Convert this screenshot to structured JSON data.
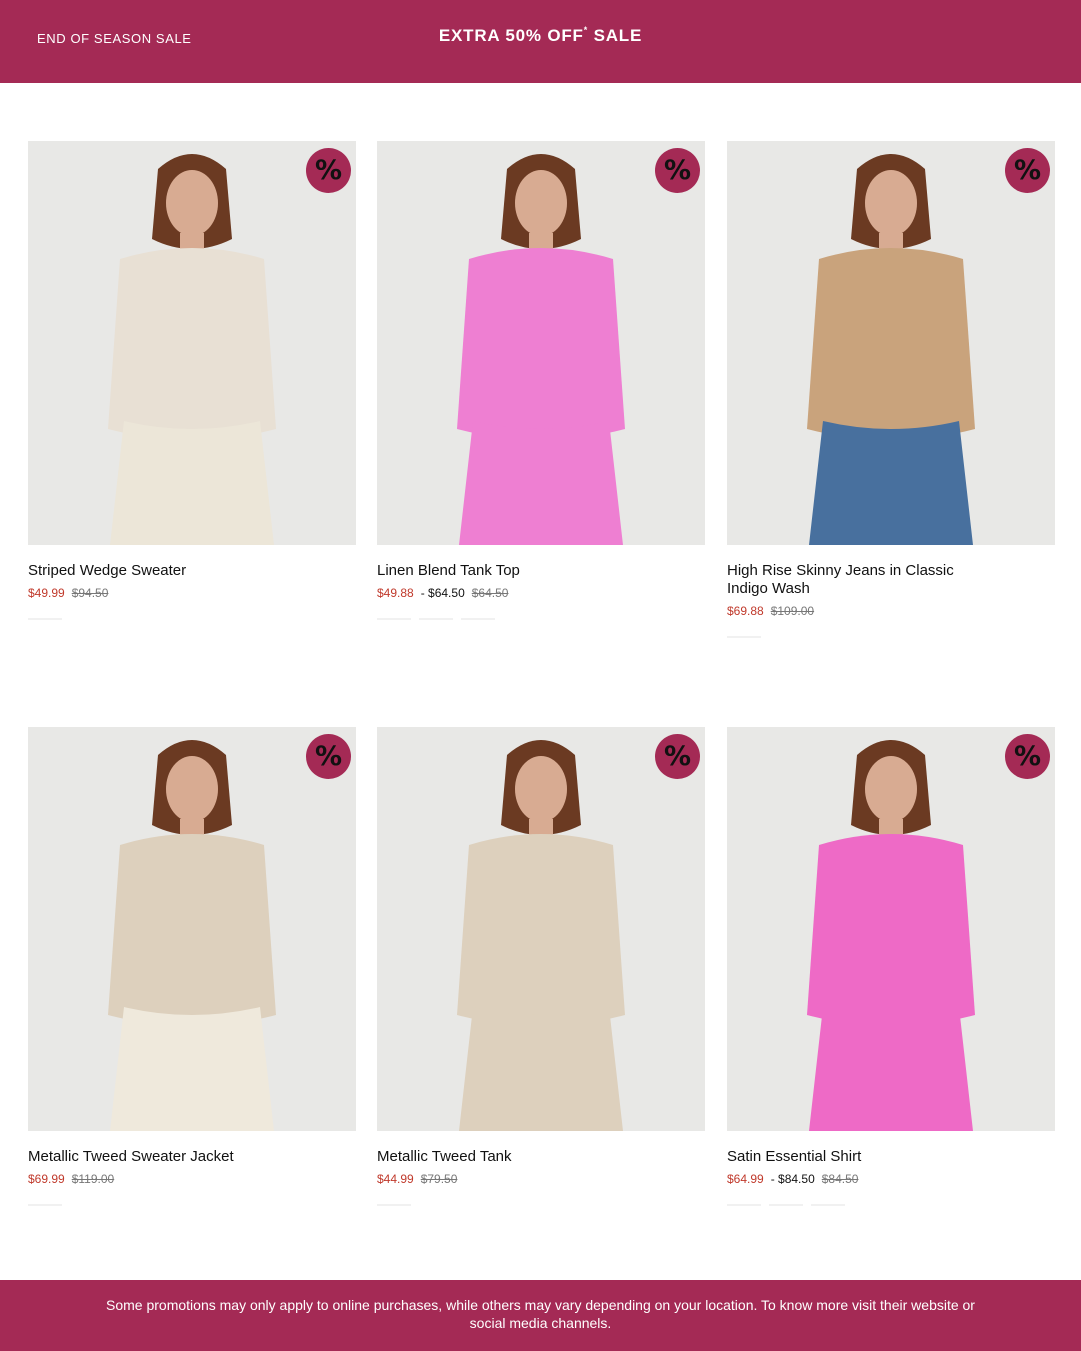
{
  "banner": {
    "left_label": "END OF SEASON SALE",
    "center_label": "EXTRA 50% OFF",
    "center_mark": "*",
    "center_suffix": "SALE",
    "color": "#a42a55"
  },
  "products": [
    {
      "name": "Striped Wedge Sweater",
      "sale": "$49.99",
      "range_high": "",
      "original": "$94.50",
      "badge": "%",
      "garment_color": "#e8e0d4",
      "bottom_color": "#ece6d8"
    },
    {
      "name": "Linen Blend Tank Top",
      "sale": "$49.88",
      "range_high": "- $64.50",
      "original": "$64.50",
      "badge": "%",
      "garment_color": "#ee7fd2",
      "bottom_color": "#ee7fd2"
    },
    {
      "name": "High Rise Skinny Jeans in Classic Indigo Wash",
      "sale": "$69.88",
      "range_high": "",
      "original": "$109.00",
      "badge": "%",
      "garment_color": "#c9a37c",
      "bottom_color": "#48709e"
    },
    {
      "name": "Metallic Tweed Sweater Jacket",
      "sale": "$69.99",
      "range_high": "",
      "original": "$119.00",
      "badge": "%",
      "garment_color": "#ddd0bd",
      "bottom_color": "#efe9dc"
    },
    {
      "name": "Metallic Tweed Tank",
      "sale": "$44.99",
      "range_high": "",
      "original": "$79.50",
      "badge": "%",
      "garment_color": "#ddd0bd",
      "bottom_color": "#ddd0bd"
    },
    {
      "name": "Satin Essential Shirt",
      "sale": "$64.99",
      "range_high": "- $84.50",
      "original": "$84.50",
      "badge": "%",
      "garment_color": "#ee6ac6",
      "bottom_color": "#ee6ac6"
    }
  ],
  "footer": {
    "text": "Some promotions may only apply to online purchases, while others may vary depending on your location. To know more visit their website or social media channels."
  }
}
